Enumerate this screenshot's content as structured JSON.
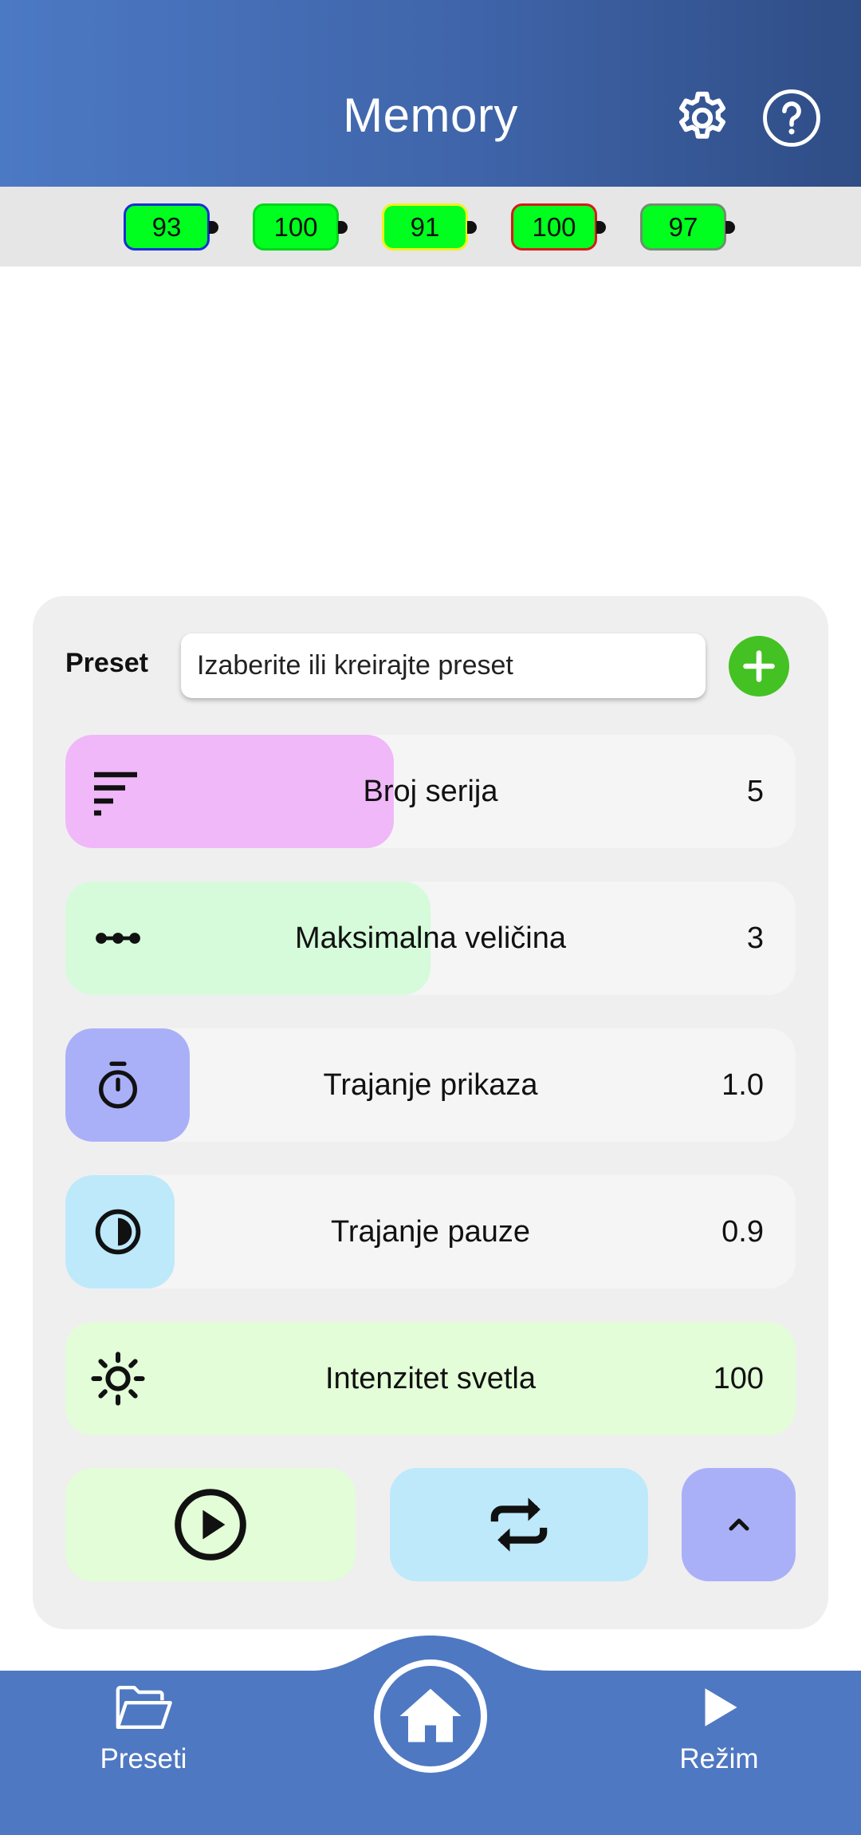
{
  "header": {
    "title": "Memory",
    "settings_icon": "gear-icon",
    "help_icon": "question-circle-icon",
    "background_start": "#4c79c4",
    "background_end": "#2f4d86"
  },
  "batteries": [
    {
      "value": "93",
      "border_color": "#1a2fd6"
    },
    {
      "value": "100",
      "border_color": "#00d61a"
    },
    {
      "value": "91",
      "border_color": "#f2f21a"
    },
    {
      "value": "100",
      "border_color": "#d61a1a"
    },
    {
      "value": "97",
      "border_color": "#6f8f6f"
    }
  ],
  "preset": {
    "label": "Preset",
    "input_value": "Izaberite ili kreirajte preset",
    "add_icon": "plus-icon",
    "add_color": "#44c123"
  },
  "params": [
    {
      "label": "Broj serija",
      "value": "5",
      "icon": "sort-lines-icon",
      "fill_color": "#f0b8f8",
      "level": 0.45
    },
    {
      "label": "Maksimalna veličina",
      "value": "3",
      "icon": "three-dots-icon",
      "fill_color": "#d5fbdb",
      "level": 0.5
    },
    {
      "label": "Trajanje prikaza",
      "value": "1.0",
      "icon": "stopwatch-icon",
      "fill_color": "#aab0f7",
      "level": 0.17
    },
    {
      "label": "Trajanje pauze",
      "value": "0.9",
      "icon": "half-circle-icon",
      "fill_color": "#bde9fb",
      "level": 0.15
    },
    {
      "label": "Intenzitet svetla",
      "value": "100",
      "icon": "sun-icon",
      "fill_color": "#e2fdd7",
      "level": 1.0
    }
  ],
  "controls": {
    "play_icon": "play-circle-icon",
    "play_color": "#e2fdd7",
    "repeat_icon": "repeat-icon",
    "repeat_color": "#bde9fb",
    "collapse_icon": "chevron-up-icon",
    "collapse_color": "#aab0f7"
  },
  "bottom_nav": {
    "left_label": "Preseti",
    "left_icon": "folder-icon",
    "home_icon": "home-icon",
    "right_label": "Režim",
    "right_icon": "play-triangle-icon",
    "color": "#4f78c2"
  }
}
